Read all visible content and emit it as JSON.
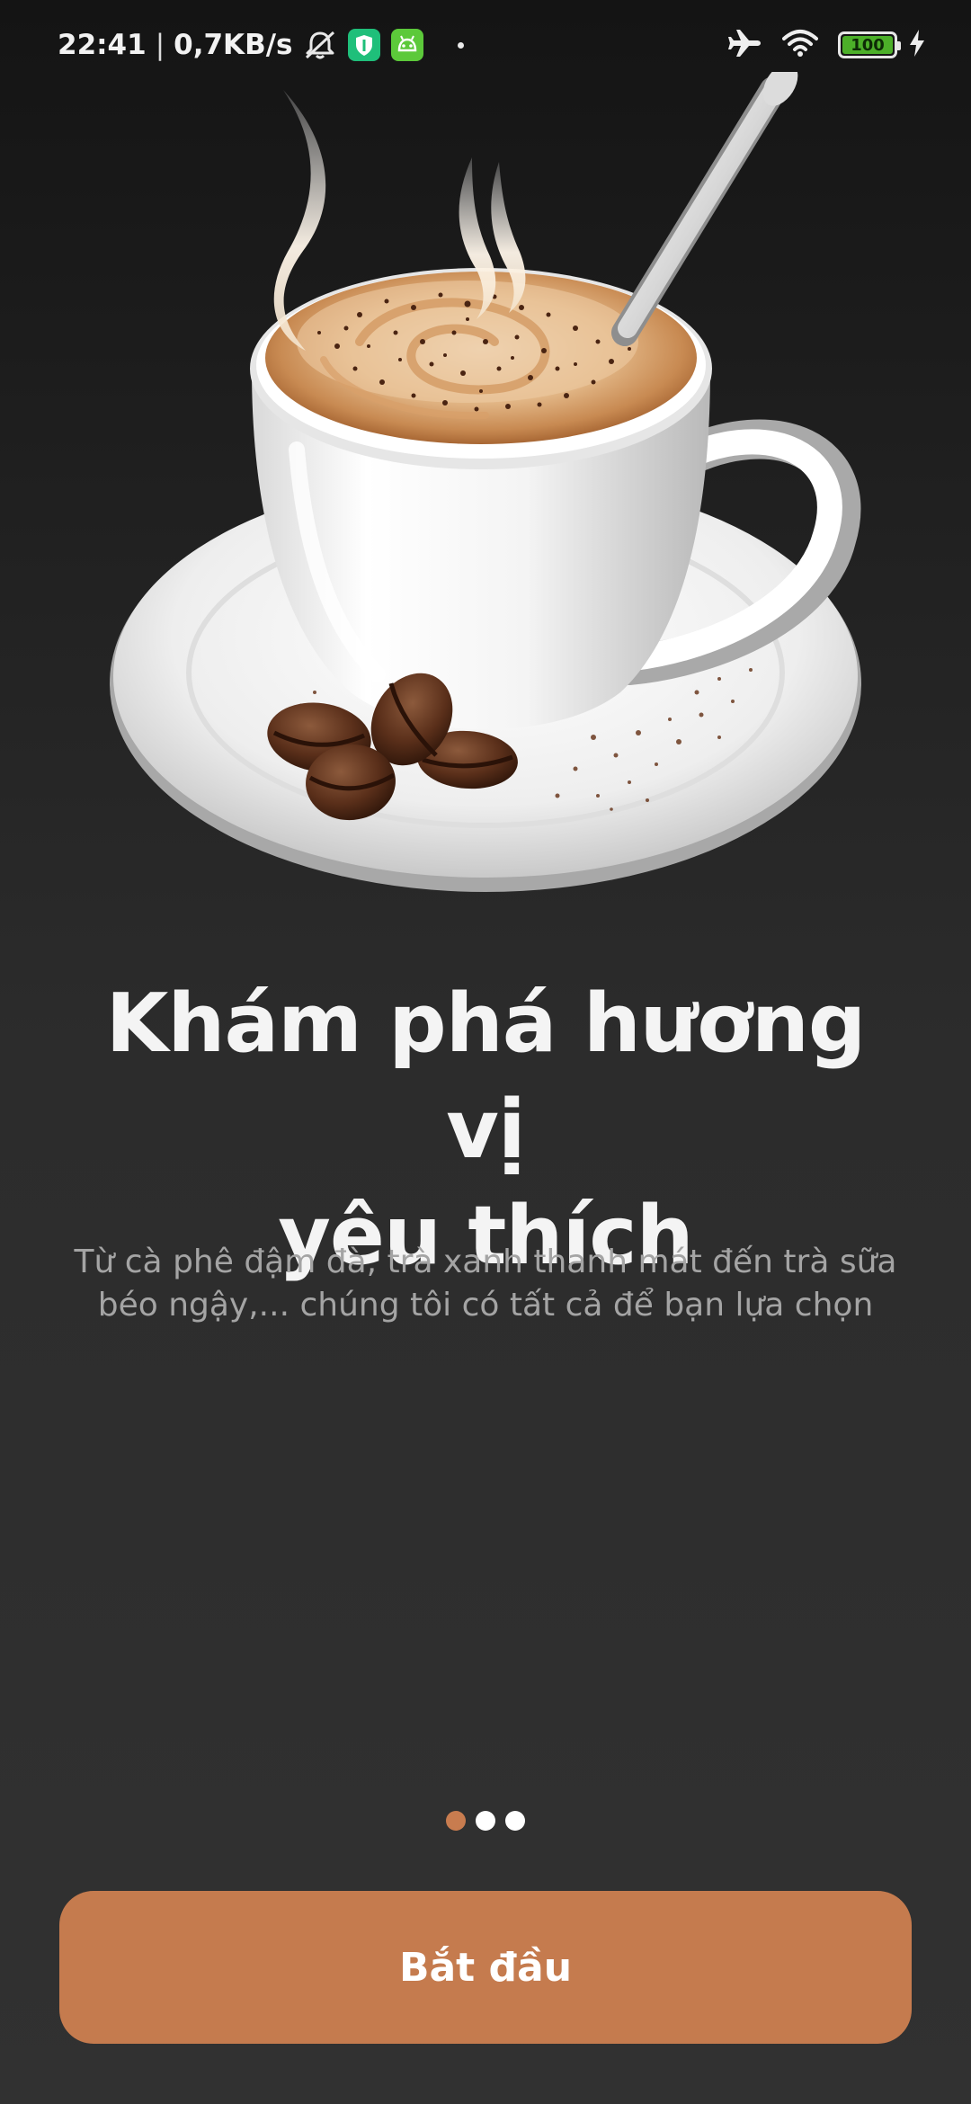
{
  "status_bar": {
    "time": "22:41",
    "separator": "|",
    "network_speed": "0,7KB/s",
    "battery_level": "100",
    "icons": [
      "mute-bell-icon",
      "shield-app-icon",
      "android-app-icon",
      "airplane-icon",
      "wifi-icon",
      "battery-icon",
      "charging-bolt-icon"
    ],
    "colors": {
      "battery_fill": "#4caf29",
      "shield_app": "#1fbf7a",
      "android_app": "#5cc93a"
    }
  },
  "hero": {
    "image": "coffee-cup-illustration"
  },
  "onboarding": {
    "title_line1": "Khám phá hương vị",
    "title_line2": "yêu thích",
    "subtitle_line1": "Từ cà phê đậm đà, trà xanh thanh mát đến trà sữa",
    "subtitle_line2": "béo ngậy,... chúng tôi có tất cả để bạn lựa chọn",
    "pages_total": 3,
    "current_page": 1
  },
  "cta": {
    "label": "Bắt đầu"
  },
  "colors": {
    "accent": "#c57b4e",
    "title": "#f4f4f4",
    "subtitle": "#a4a4a4",
    "background": "#2c2c2c"
  }
}
